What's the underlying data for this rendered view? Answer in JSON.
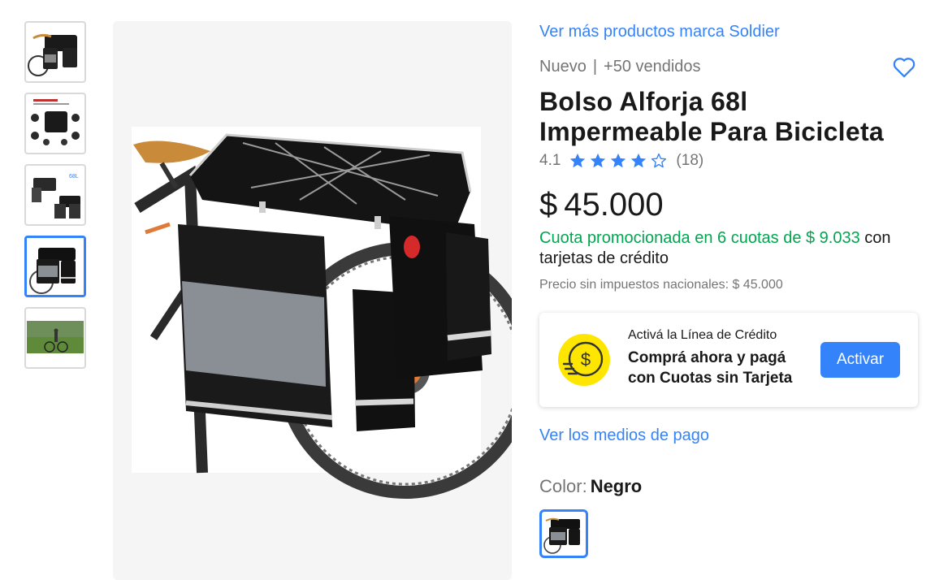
{
  "brand_link": "Ver más productos marca Soldier",
  "condition": "Nuevo",
  "separator": "|",
  "sold": "+50 vendidos",
  "title": "Bolso Alforja 68l Impermeable Para Bicicleta",
  "rating": {
    "value": "4.1",
    "stars": 4.1,
    "count": "(18)"
  },
  "price": {
    "currency": "$",
    "amount": "45.000"
  },
  "installments": {
    "promo": "Cuota promocionada en 6 cuotas de $ 9.033",
    "rest": " con tarjetas de crédito"
  },
  "tax_note": "Precio sin impuestos nacionales: $ 45.000",
  "credit": {
    "subtitle": "Activá la Línea de Crédito",
    "main": "Comprá ahora y pagá con Cuotas sin Tarjeta",
    "button": "Activar"
  },
  "payment_link": "Ver los medios de pago",
  "color": {
    "label": "Color:",
    "value": "Negro"
  },
  "colors": {
    "accent": "#3483fa",
    "promo": "#00a650",
    "coin": "#ffe600"
  },
  "thumbnails": {
    "count": 5,
    "active_index": 3
  }
}
